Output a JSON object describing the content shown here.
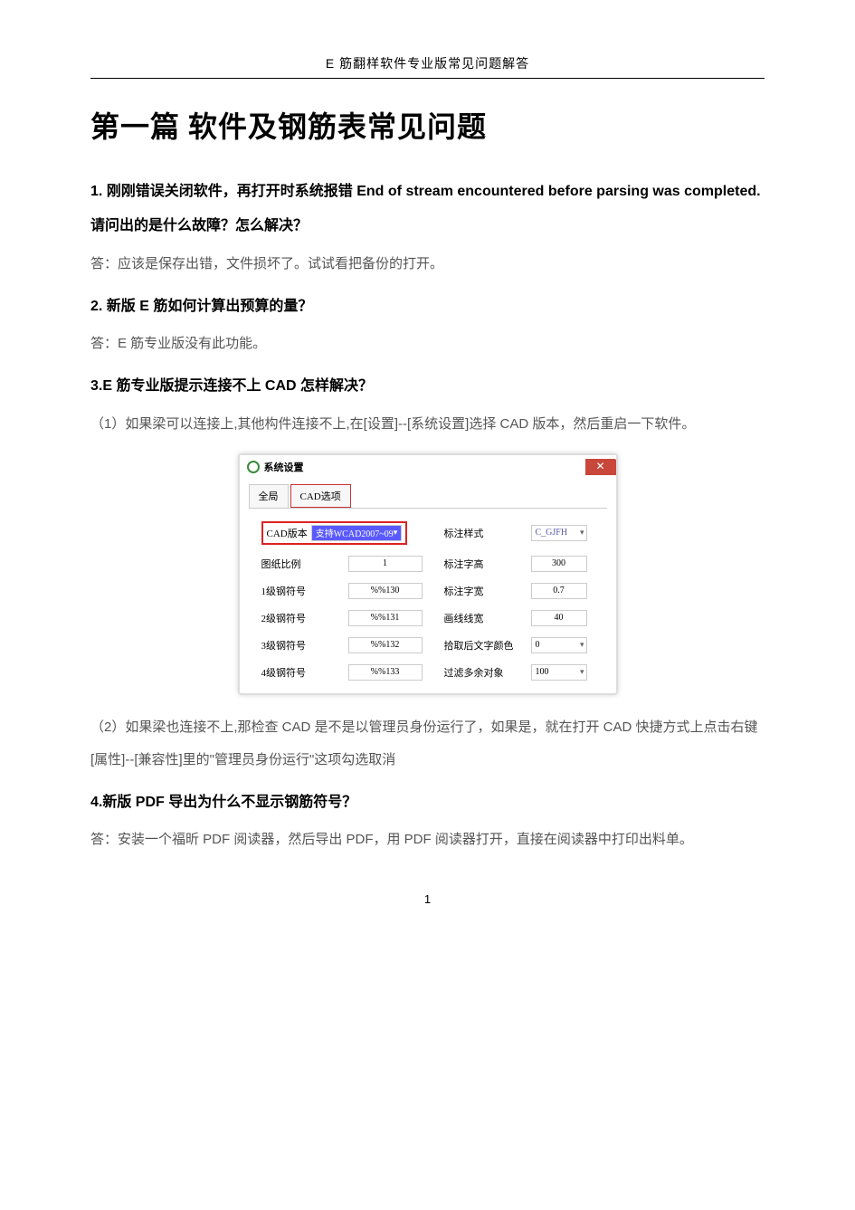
{
  "header": "E 筋翻样软件专业版常见问题解答",
  "title": "第一篇  软件及钢筋表常见问题",
  "q1": "1.  刚刚错误关闭软件，再打开时系统报错 End of stream encountered before parsing was completed.请问出的是什么故障？怎么解决？",
  "a1": "答：应该是保存出错，文件损坏了。试试看把备份的打开。",
  "q2": "2.  新版 E 筋如何计算出预算的量？",
  "a2": "答：E 筋专业版没有此功能。",
  "q3": "3.E 筋专业版提示连接不上 CAD 怎样解决？",
  "p3_1": "（1）如果梁可以连接上,其他构件连接不上,在[设置]--[系统设置]选择 CAD 版本，然后重启一下软件。",
  "p3_2": "（2）如果梁也连接不上,那检查 CAD 是不是以管理员身份运行了，如果是，就在打开 CAD 快捷方式上点击右键[属性]--[兼容性]里的\"管理员身份运行\"这项勾选取消",
  "q4": "4.新版 PDF 导出为什么不显示钢筋符号？",
  "a4": "答：安装一个福昕 PDF 阅读器，然后导出 PDF，用 PDF 阅读器打开，直接在阅读器中打印出料单。",
  "dialog": {
    "title": "系统设置",
    "tabs": [
      "全局",
      "CAD选项"
    ],
    "left_rows": [
      {
        "label": "CAD版本",
        "value": "支持WCAD2007~09",
        "highlight": true,
        "dropdown": true
      },
      {
        "label": "图纸比例",
        "value": "1"
      },
      {
        "label": "1级钢符号",
        "value": "%%130"
      },
      {
        "label": "2级钢符号",
        "value": "%%131"
      },
      {
        "label": "3级钢符号",
        "value": "%%132"
      },
      {
        "label": "4级钢符号",
        "value": "%%133"
      }
    ],
    "right_rows": [
      {
        "label": "标注样式",
        "value": "C_GJFH",
        "dropdown": true
      },
      {
        "label": "标注字高",
        "value": "300"
      },
      {
        "label": "标注字宽",
        "value": "0.7"
      },
      {
        "label": "画线线宽",
        "value": "40"
      },
      {
        "label": "拾取后文字颜色",
        "value": "0",
        "dropdown": true
      },
      {
        "label": "过滤多余对象",
        "value": "100",
        "dropdown": true
      }
    ]
  },
  "page_num": "1"
}
